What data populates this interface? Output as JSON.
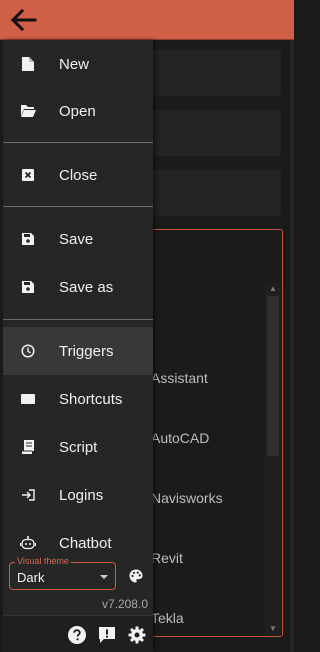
{
  "header": {
    "back_icon": "arrow-left-icon",
    "accent": "#cf5f47"
  },
  "drawer": {
    "items": [
      {
        "label": "New",
        "icon": "new-file-icon"
      },
      {
        "label": "Open",
        "icon": "folder-open-icon"
      },
      {
        "label": "Close",
        "icon": "close-box-icon"
      },
      {
        "label": "Save",
        "icon": "save-icon"
      },
      {
        "label": "Save as",
        "icon": "save-as-icon"
      },
      {
        "label": "Triggers",
        "icon": "clock-icon",
        "active": true
      },
      {
        "label": "Shortcuts",
        "icon": "keyboard-icon"
      },
      {
        "label": "Script",
        "icon": "script-icon"
      },
      {
        "label": "Logins",
        "icon": "login-icon"
      },
      {
        "label": "Chatbot",
        "icon": "robot-icon"
      }
    ],
    "visual_theme": {
      "legend": "Visual theme",
      "value": "Dark"
    },
    "version": "v7.208.0",
    "footer_icons": [
      "help-icon",
      "feedback-icon",
      "settings-icon"
    ]
  },
  "background_list": {
    "items": [
      "Assistant",
      "AutoCAD",
      "Navisworks",
      "Revit",
      "Tekla"
    ]
  }
}
